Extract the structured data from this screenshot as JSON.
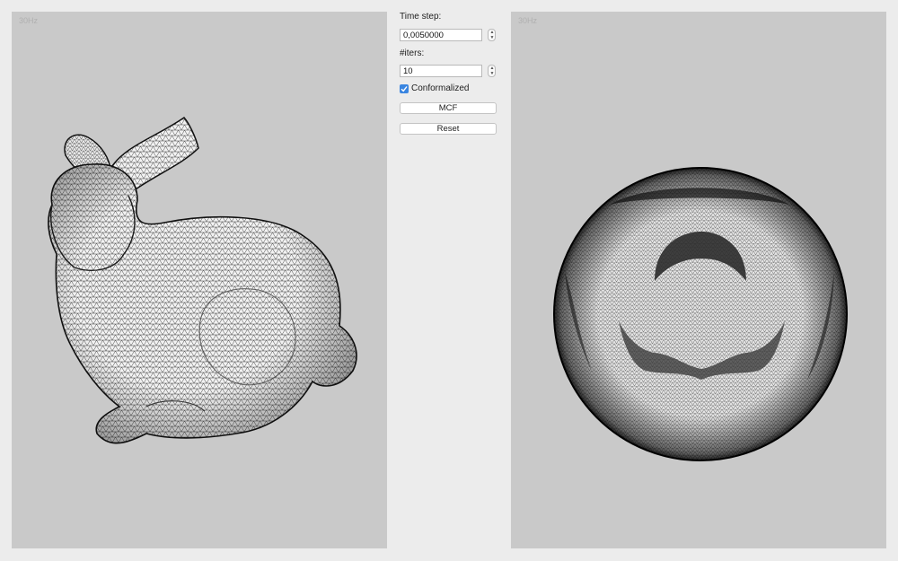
{
  "left_view": {
    "fps": "30Hz",
    "mesh": "bunny-mesh"
  },
  "right_view": {
    "fps": "30Hz",
    "mesh": "sphere-mesh"
  },
  "controls": {
    "time_step_label": "Time step:",
    "time_step_value": "0,0050000",
    "iters_label": "#iters:",
    "iters_value": "10",
    "conformalized_label": "Conformalized",
    "conformalized_checked": true,
    "mcf_button": "MCF",
    "reset_button": "Reset",
    "stepper_up_icon": "chevron-up-icon",
    "stepper_down_icon": "chevron-down-icon"
  },
  "colors": {
    "viewport_bg": "#c9c9c9",
    "panel_bg": "#ececec",
    "checkbox_accent": "#3a85e0"
  }
}
